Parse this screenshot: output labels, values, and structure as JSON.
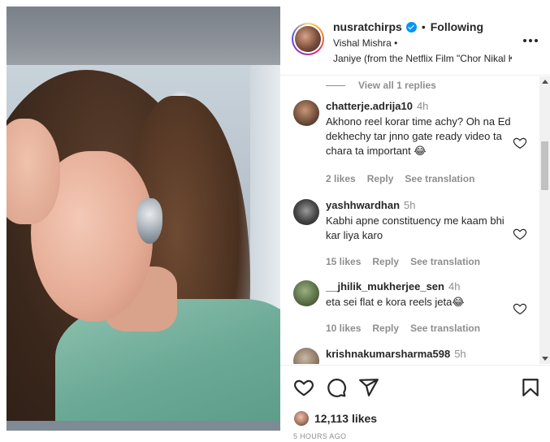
{
  "post": {
    "username": "nusratchirps",
    "separator": "•",
    "follow_status": "Following",
    "artist": "Vishal Mishra •",
    "song": "Janiye (from the Netflix Film \"Chor Nikal Ke Bhaga\")"
  },
  "comments": {
    "view_replies": "View all 1 replies",
    "items": [
      {
        "user": "chatterje.adrija10",
        "time": "4h",
        "text": "Akhono reel korar time achy? Oh na Ed dekhechy tar jnno gate ready video ta chara ta important 😂",
        "likes": "2 likes",
        "reply": "Reply",
        "translate": "See translation"
      },
      {
        "user": "yashhwardhan",
        "time": "5h",
        "text": "Kabhi apne constituency me kaam bhi kar liya karo",
        "likes": "15 likes",
        "reply": "Reply",
        "translate": "See translation"
      },
      {
        "user": "__jhilik_mukherjee_sen",
        "time": "4h",
        "text": "eta sei flat e kora reels jeta😂",
        "likes": "10 likes",
        "reply": "Reply",
        "translate": "See translation"
      },
      {
        "user": "krishnakumarsharma598",
        "time": "5h",
        "text": "",
        "likes": "",
        "reply": "",
        "translate": ""
      }
    ]
  },
  "actions": {
    "icons": [
      "heart-icon",
      "comment-icon",
      "share-icon",
      "bookmark-icon"
    ],
    "likes": "12,113 likes",
    "timestamp": "5 HOURS AGO"
  },
  "colors": {
    "verified": "#0095f6",
    "text": "#262626",
    "muted": "#8e8e8e"
  }
}
